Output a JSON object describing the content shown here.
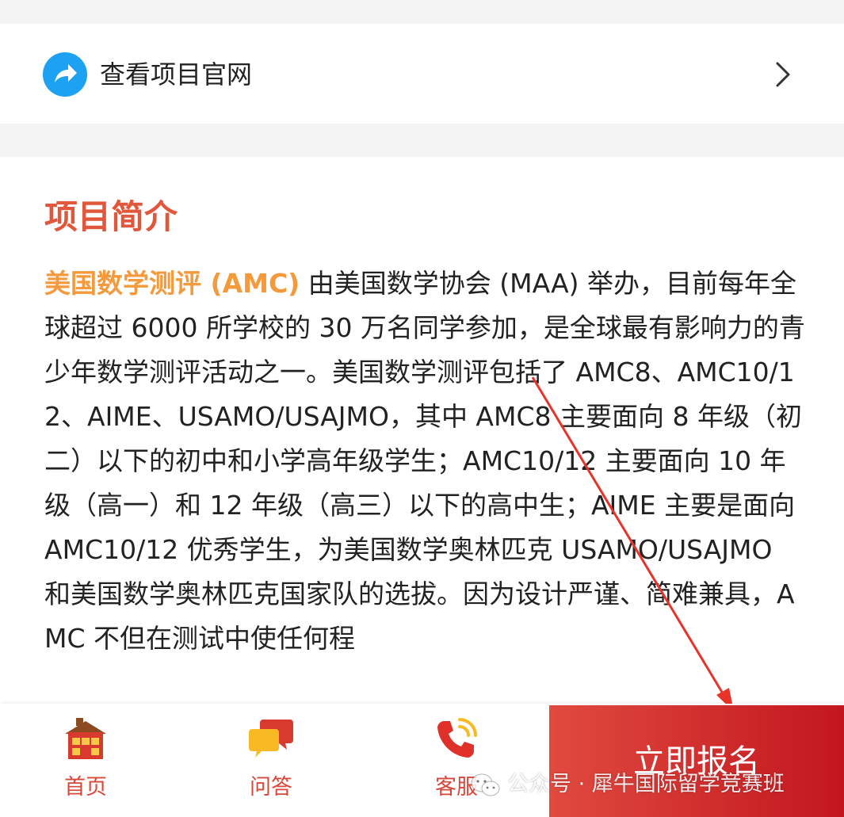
{
  "link_row": {
    "label": "查看项目官网",
    "icon": "share-arrow-icon",
    "accent": "#1da1f2"
  },
  "section": {
    "title": "项目简介",
    "title_color": "#e0573b",
    "highlight": "美国数学测评 (AMC)",
    "highlight_color": "#f49a3d",
    "body": " 由美国数学协会 (MAA) 举办，目前每年全球超过 6000 所学校的 30 万名同学参加，是全球最有影响力的青少年数学测评活动之一。美国数学测评包括了 AMC8、AMC10/12、AIME、USAMO/USAJMO，其中 AMC8 主要面向 8 年级（初二）以下的初中和小学高年级学生；AMC10/12 主要面向 10 年级（高一）和 12 年级（高三）以下的高中生；AIME 主要是面向 AMC10/12 优秀学生，为美国数学奥林匹克 USAMO/USAJMO 和美国数学奥林匹克国家队的选拔。因为设计严谨、简难兼具，AMC 不但在测试中使任何程"
  },
  "bottom_nav": {
    "items": [
      {
        "label": "首页",
        "icon": "home-icon"
      },
      {
        "label": "问答",
        "icon": "chat-bubbles-icon"
      },
      {
        "label": "客服",
        "icon": "phone-icon"
      }
    ],
    "label_color": "#d8473a",
    "signup_label": "立即报名",
    "signup_color": "#d4282a"
  },
  "watermark": {
    "text": "公众号 · 犀牛国际留学竞赛班",
    "icon": "wechat-icon"
  }
}
